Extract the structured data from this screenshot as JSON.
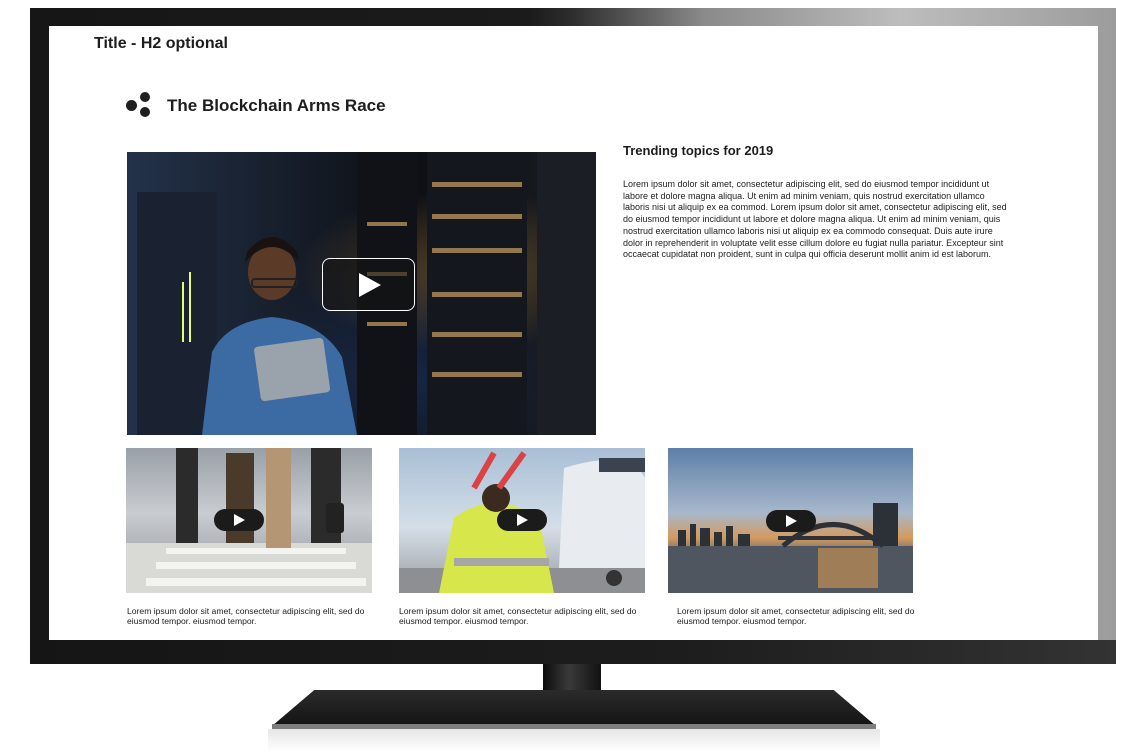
{
  "page": {
    "title": "Title - H2 optional",
    "section_title": "The Blockchain Arms Race"
  },
  "feature": {
    "heading": "Trending topics for 2019",
    "body": "Lorem ipsum dolor sit amet, consectetur adipiscing elit, sed do eiusmod tempor incididunt ut labore et dolore magna aliqua. Ut enim ad minim veniam, quis nostrud exercitation ullamco laboris nisi ut aliquip ex ea commod. Lorem ipsum dolor sit amet, consectetur adipiscing elit, sed do eiusmod tempor incididunt ut labore et dolore magna aliqua. Ut enim ad minim veniam, quis nostrud exercitation ullamco laboris nisi ut aliquip ex ea commodo consequat. Duis aute irure dolor in reprehenderit in voluptate velit esse cillum dolore eu fugiat nulla pariatur. Excepteur sint occaecat cupidatat non proident, sunt in culpa qui officia deserunt mollit anim id est laborum."
  },
  "videos": [
    {
      "caption": "Lorem ipsum dolor sit amet, consectetur adipiscing elit, sed do eiusmod tempor. eiusmod tempor."
    },
    {
      "caption": "Lorem ipsum dolor sit amet, consectetur adipiscing elit, sed do eiusmod tempor. eiusmod tempor."
    },
    {
      "caption": "Lorem ipsum dolor sit amet, consectetur adipiscing elit, sed do eiusmod tempor.  eiusmod tempor."
    }
  ],
  "icons": {
    "logo": "three-dots-logo-icon",
    "play": "play-icon"
  },
  "colors": {
    "text": "#1d1d1d",
    "screen_bg": "#ffffff",
    "tv_frame": "#1b1b1b"
  }
}
